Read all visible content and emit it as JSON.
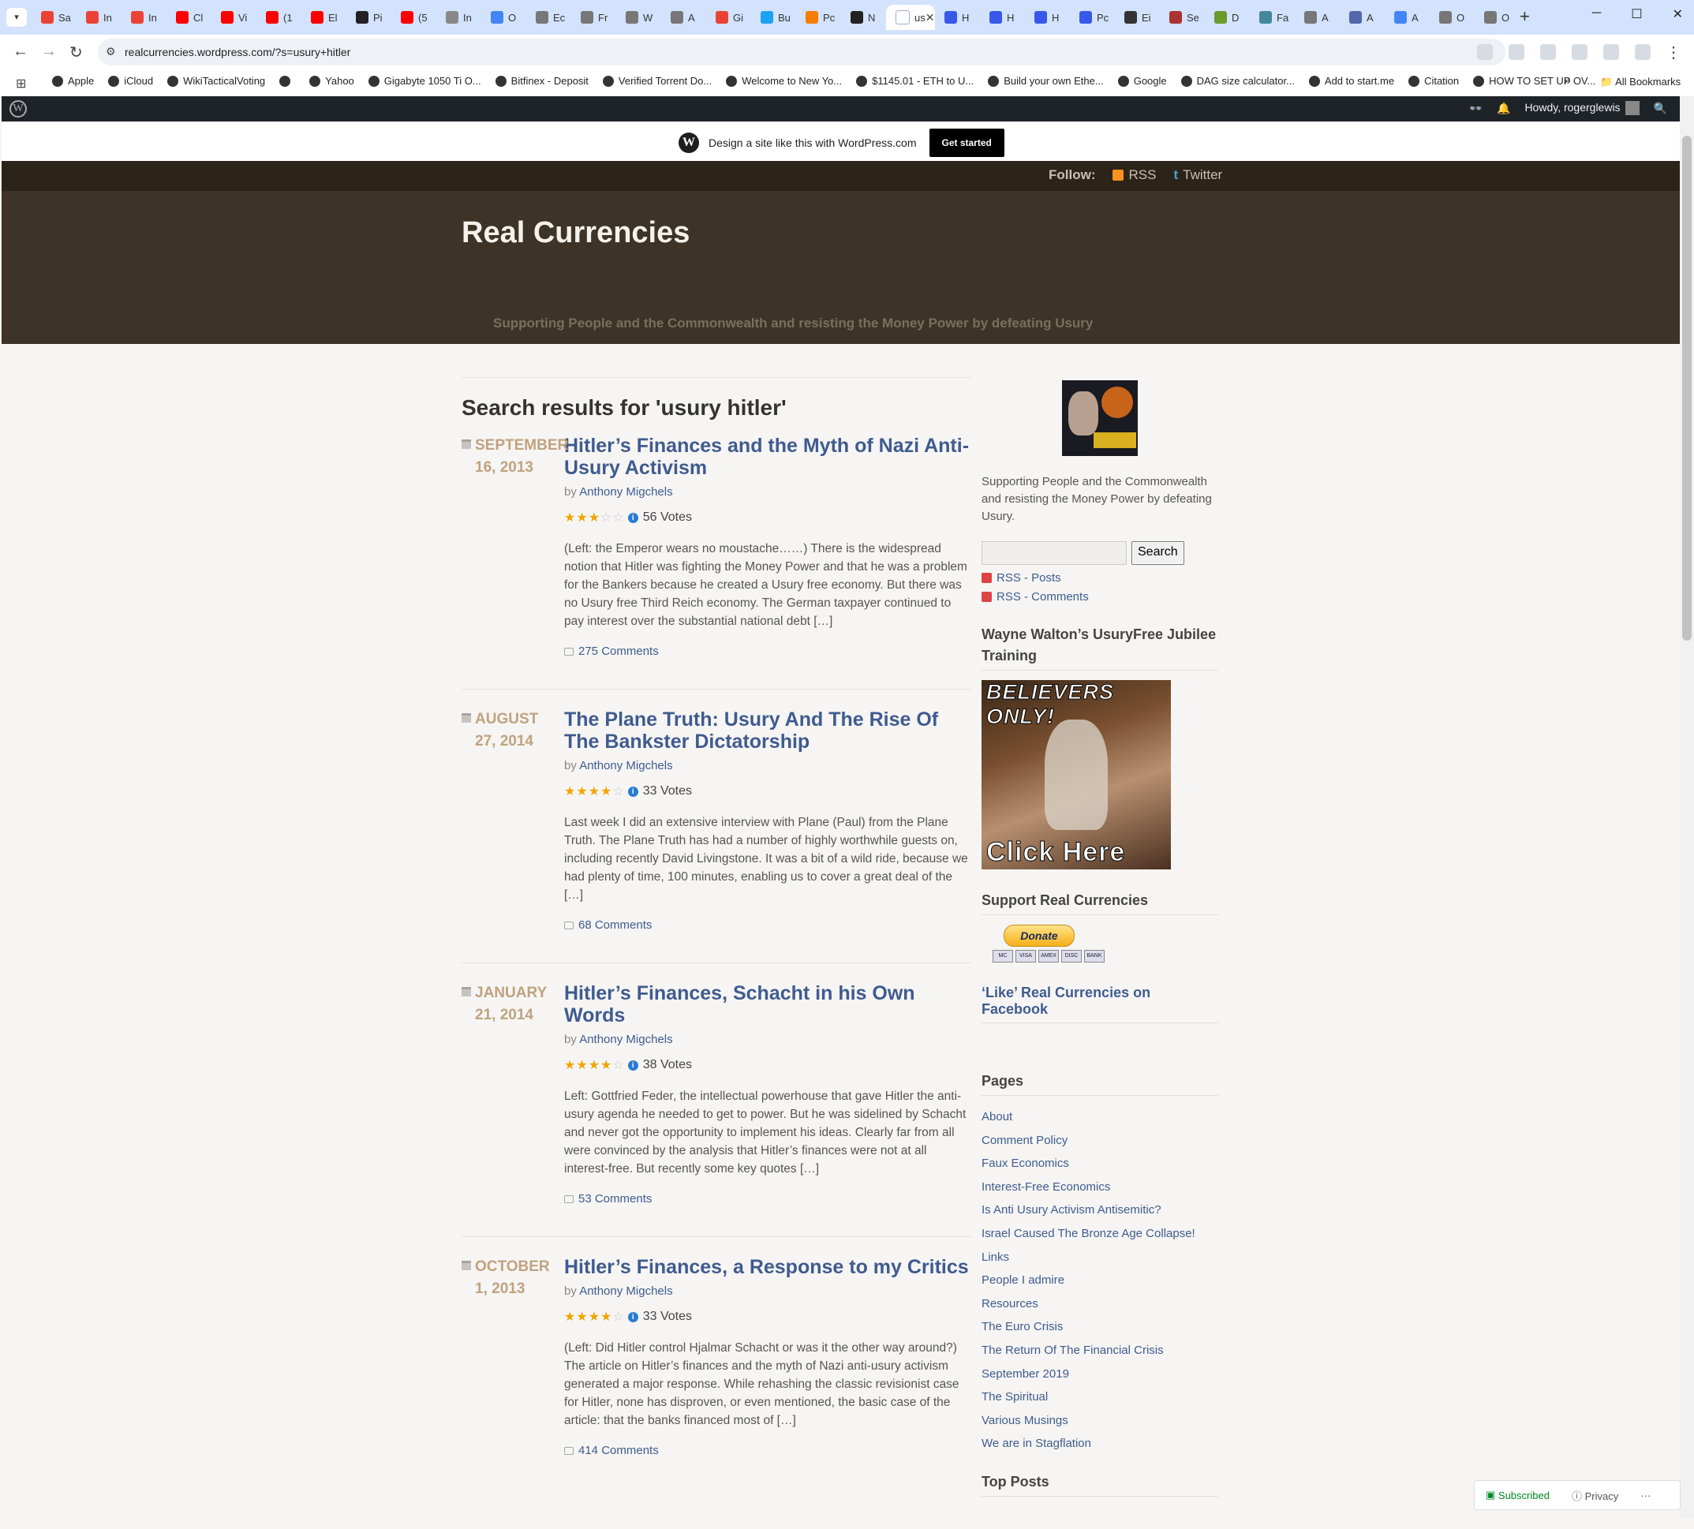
{
  "browser": {
    "tabs": [
      {
        "label": "Sa",
        "color": "#ea4335"
      },
      {
        "label": "In",
        "color": "#ea4335"
      },
      {
        "label": "In",
        "color": "#ea4335"
      },
      {
        "label": "Cl",
        "color": "#ff0000"
      },
      {
        "label": "Vi",
        "color": "#ff0000"
      },
      {
        "label": "(1",
        "color": "#ff0000"
      },
      {
        "label": "El",
        "color": "#ff0000"
      },
      {
        "label": "Pi",
        "color": "#222222"
      },
      {
        "label": "(5",
        "color": "#ff0000"
      },
      {
        "label": "In",
        "color": "#888888"
      },
      {
        "label": "O",
        "color": "#4285f4"
      },
      {
        "label": "Ec",
        "color": "#777777"
      },
      {
        "label": "Fr",
        "color": "#777777"
      },
      {
        "label": "W",
        "color": "#777777"
      },
      {
        "label": "A",
        "color": "#777777"
      },
      {
        "label": "Gi",
        "color": "#ea4335"
      },
      {
        "label": "Bu",
        "color": "#1da1f2"
      },
      {
        "label": "Pc",
        "color": "#f57d00"
      },
      {
        "label": "N",
        "color": "#222222"
      },
      {
        "label": "us",
        "color": "#d3e3fd",
        "active": true
      },
      {
        "label": "H",
        "color": "#3858e9"
      },
      {
        "label": "H",
        "color": "#3858e9"
      },
      {
        "label": "H",
        "color": "#3858e9"
      },
      {
        "label": "Pc",
        "color": "#3858e9"
      },
      {
        "label": "Ei",
        "color": "#333333"
      },
      {
        "label": "Se",
        "color": "#aa3333"
      },
      {
        "label": "D",
        "color": "#6a9a2a"
      },
      {
        "label": "Fa",
        "color": "#448899"
      },
      {
        "label": "A",
        "color": "#777777"
      },
      {
        "label": "A",
        "color": "#5566aa"
      },
      {
        "label": "A",
        "color": "#4285f4"
      },
      {
        "label": "O",
        "color": "#777777"
      },
      {
        "label": "O",
        "color": "#777777"
      }
    ],
    "tab_close": "✕",
    "new_tab": "+",
    "url": "realcurrencies.wordpress.com/?s=usury+hitler",
    "bookmarks": [
      {
        "label": "Apple"
      },
      {
        "label": "iCloud"
      },
      {
        "label": "WikiTacticalVoting"
      },
      {
        "label": ""
      },
      {
        "label": "Yahoo"
      },
      {
        "label": "Gigabyte 1050 Ti O..."
      },
      {
        "label": "Bitfinex - Deposit"
      },
      {
        "label": "Verified Torrent Do..."
      },
      {
        "label": "Welcome to New Yo..."
      },
      {
        "label": "$1145.01 - ETH to U..."
      },
      {
        "label": "Build your own Ethe..."
      },
      {
        "label": "Google"
      },
      {
        "label": "DAG size calculator..."
      },
      {
        "label": "Add to start.me"
      },
      {
        "label": "Citation"
      },
      {
        "label": "HOW TO SET UP OV..."
      }
    ],
    "bookmarks_more": "»",
    "all_bookmarks": "All Bookmarks"
  },
  "wp_admin": {
    "howdy": "Howdy, rogerglewis"
  },
  "promo": {
    "text": "Design a site like this with WordPress.com",
    "button": "Get started"
  },
  "site": {
    "follow_label": "Follow:",
    "rss": "RSS",
    "twitter": "Twitter",
    "title": "Real Currencies",
    "tagline": "Supporting People and the Commonwealth and resisting the Money Power by defeating Usury"
  },
  "main": {
    "results_title": "Search results for 'usury hitler'",
    "posts": [
      {
        "date_line1": "SEPTEMBER",
        "date_line2": "16, 2013",
        "title": "Hitler’s Finances and the Myth of Nazi Anti-Usury Activism",
        "by": "by",
        "author": "Anthony Migchels",
        "stars": 3,
        "half": false,
        "votes": "56 Votes",
        "excerpt": "(Left: the Emperor wears no moustache……) There is the widespread notion that Hitler was fighting the Money Power and that he was a problem for the Bankers because he created a Usury free economy. But there was no Usury free Third Reich economy. The German taxpayer continued to pay interest over the substantial national debt […]",
        "comments": "275 Comments"
      },
      {
        "date_line1": "AUGUST",
        "date_line2": "27, 2014",
        "title": "The Plane Truth: Usury And The Rise Of The Bankster Dictatorship",
        "by": "by",
        "author": "Anthony Migchels",
        "stars": 3,
        "half": true,
        "votes": "33 Votes",
        "excerpt": "Last week I did an extensive interview with Plane (Paul) from the Plane Truth. The Plane Truth has had a number of highly worthwhile guests on, including recently David Livingstone. It was a bit of a wild ride, because we had plenty of time, 100 minutes, enabling us to cover a great deal of the […]",
        "comments": "68 Comments"
      },
      {
        "date_line1": "JANUARY",
        "date_line2": "21, 2014",
        "title": "Hitler’s Finances, Schacht in his Own Words",
        "by": "by",
        "author": "Anthony Migchels",
        "stars": 4,
        "half": false,
        "votes": "38 Votes",
        "excerpt": "Left: Gottfried Feder, the intellectual powerhouse that gave Hitler the anti-usury agenda he needed to get to power. But he was sidelined by Schacht and never got the opportunity to implement his ideas. Clearly far from all were convinced by the analysis that Hitler’s finances were not at all interest-free. But recently some key quotes […]",
        "comments": "53 Comments"
      },
      {
        "date_line1": "OCTOBER",
        "date_line2": "1, 2013",
        "title": "Hitler’s Finances, a Response to my Critics",
        "by": "by",
        "author": "Anthony Migchels",
        "stars": 4,
        "half": false,
        "votes": "33 Votes",
        "excerpt": "(Left: Did Hitler control Hjalmar Schacht or was it the other way around?) The article on Hitler’s finances and the myth of Nazi anti-usury activism generated a major response. While rehashing the classic revisionist case for Hitler, none has disproven, or even mentioned, the basic case of the article: that the banks financed most of […]",
        "comments": "414 Comments"
      }
    ]
  },
  "sidebar": {
    "description": "Supporting People and the Commonwealth and resisting the Money Power by defeating Usury.",
    "search_button": "Search",
    "rss_posts": "RSS - Posts",
    "rss_comments": "RSS - Comments",
    "training_title": "Wayne Walton’s UsuryFree Jubilee Training",
    "ad_top": "BELIEVERS ONLY!",
    "ad_bottom": "Click Here",
    "support_title": "Support Real Currencies",
    "donate": "Donate",
    "cards": [
      "MC",
      "VISA",
      "AMEX",
      "DISC",
      "BANK"
    ],
    "facebook": "‘Like’ Real Currencies on Facebook",
    "pages_title": "Pages",
    "pages": [
      "About",
      "Comment Policy",
      "Faux Economics",
      "Interest-Free Economics",
      "Is Anti Usury Activism Antisemitic?",
      "Israel Caused The Bronze Age Collapse!",
      "Links",
      "People I admire",
      "Resources",
      "The Euro Crisis",
      "The Return Of The Financial Crisis",
      "September 2019",
      "The Spiritual",
      "Various Musings",
      "We are in Stagflation"
    ],
    "top_posts_title": "Top Posts"
  },
  "overlay": {
    "subscribed": "Subscribed",
    "privacy": "Privacy",
    "more": "···"
  },
  "colors": {
    "link": "#3f5b8f",
    "header_bg": "#3d3427",
    "date": "#c0a27f"
  }
}
